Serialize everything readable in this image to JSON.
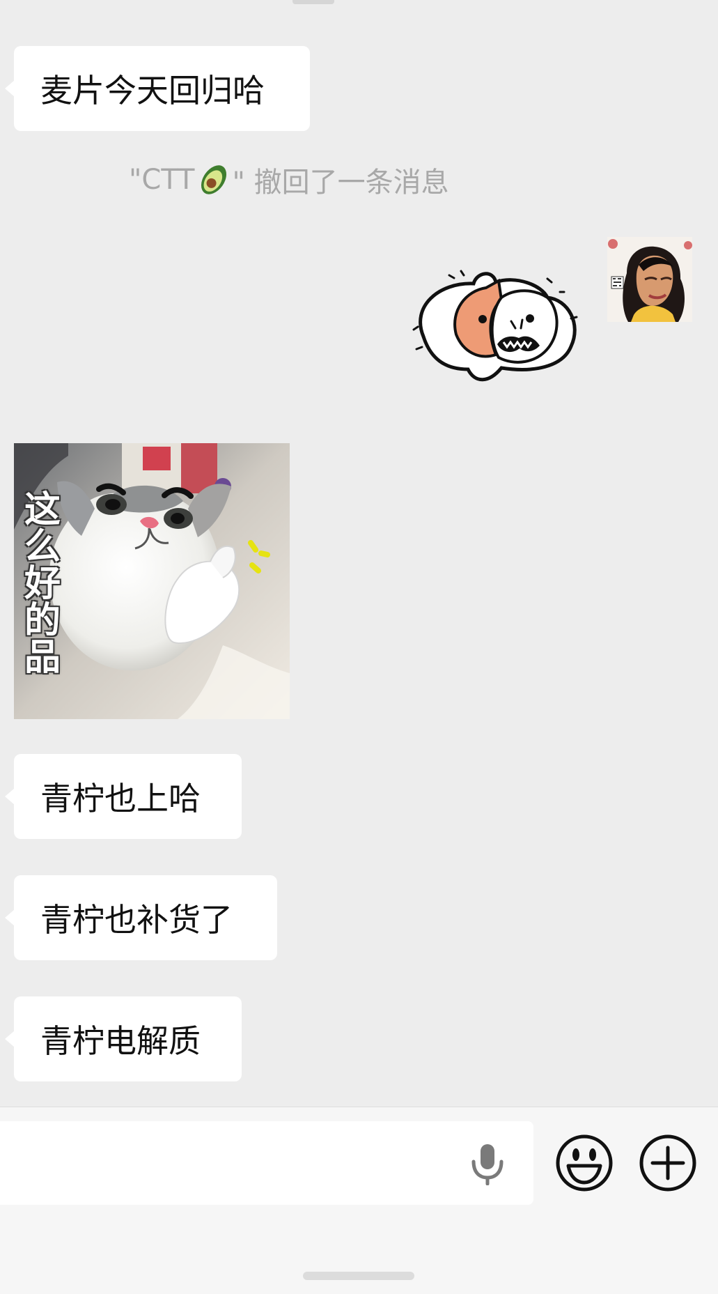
{
  "messages": {
    "incoming_1": "麦片今天回归哈",
    "recall_prefix": "\"CTT",
    "recall_suffix": "\" 撤回了一条消息",
    "cat_caption": "这么好的品",
    "incoming_2": "青柠也上哈",
    "incoming_3": "青柠也补货了",
    "incoming_4": "青柠电解质"
  },
  "input_bar": {
    "placeholder": ""
  },
  "icons": {
    "sticker": "cat-sticker-icon",
    "avatar": "profile-avatar-icon",
    "microphone": "microphone-icon",
    "emoji": "emoji-icon",
    "plus": "plus-icon"
  },
  "colors": {
    "background": "#ededed",
    "bubble": "#ffffff",
    "system_text": "#a8a8a8",
    "input_bar": "#f6f6f6"
  }
}
